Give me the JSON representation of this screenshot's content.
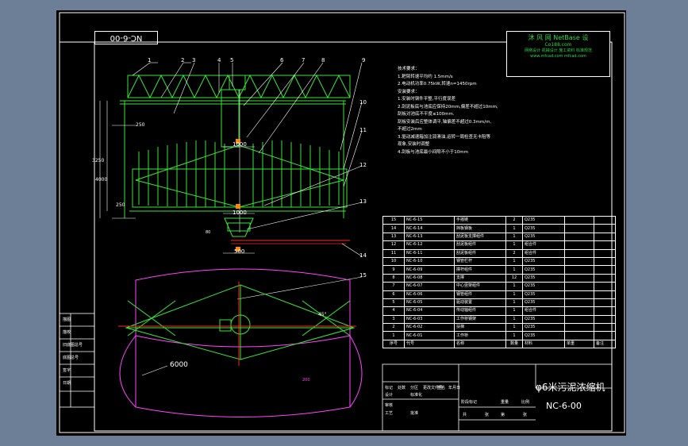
{
  "drawing": {
    "number_box": "NC-6-00",
    "title": "φ6米污泥浓缩机",
    "title_number": "NC-6-00"
  },
  "watermark": {
    "line1": "沐 风 网  NetBase 设",
    "line2": "Co188.com",
    "line3": "网络设计 机械设计 施工资料 标准规范",
    "line4": "www.mfcad.com mfcad.com"
  },
  "notes": [
    "技术要求：",
    "1.耙臂转速平均约 1.5mm/s",
    "2.电动机功率0.75kW,转速n=1450rpm",
    "安装要求：",
    "1.安装时钢件平整,平行度误差",
    "2.刮泥板底与池底应保持20mm,偏差不超过10mm,",
    "  刮板对池底不平度≤100mm.",
    "  刮板安装后应整体调平,轴偏差不超过0.3mm/m,",
    "  不超过2mm",
    "3.驱动减速箱加注润滑油,运转一周检查无卡阻等",
    "  现象,安装时调整",
    "4.刮板与池底最小间隙不小于10mm"
  ],
  "dimensions": {
    "d1000_top": "1000",
    "d1000_bottom": "1000",
    "d3250": "3250",
    "d4000": "4000",
    "d500": "500",
    "d250_a": "250",
    "d250_b": "250",
    "d6000": "6000",
    "d45": "45°",
    "d80": "80",
    "d200": "200"
  },
  "callouts": [
    "1",
    "2",
    "3",
    "4",
    "5",
    "6",
    "7",
    "8",
    "9",
    "10",
    "11",
    "12",
    "13",
    "14",
    "15"
  ],
  "bom_header": [
    "序号",
    "代号",
    "名称",
    "数量",
    "材料",
    "单重",
    "备注"
  ],
  "bom": [
    [
      "15",
      "NC-6-15",
      "手摇链",
      "2",
      "Q235",
      ""
    ],
    [
      "14",
      "NC-6-14",
      "挡板钢板",
      "1",
      "Q235",
      ""
    ],
    [
      "13",
      "NC-6-13",
      "刮泥板支撑组件",
      "1",
      "Q235",
      ""
    ],
    [
      "12",
      "NC-6-12",
      "刮泥板组件",
      "1",
      "组合件",
      ""
    ],
    [
      "11",
      "NC-6-11",
      "刮泥板组件",
      "2",
      "组合件",
      ""
    ],
    [
      "10",
      "NC-6-10",
      "钢管栏杆",
      "1",
      "Q235",
      ""
    ],
    [
      "9",
      "NC-6-09",
      "撑杆组件",
      "1",
      "Q235",
      ""
    ],
    [
      "8",
      "NC-6-08",
      "支撑",
      "12",
      "Q235",
      ""
    ],
    [
      "7",
      "NC-6-07",
      "中心竖架组件",
      "1",
      "Q235",
      ""
    ],
    [
      "6",
      "NC-6-06",
      "钢管组件",
      "1",
      "Q235",
      ""
    ],
    [
      "5",
      "NC-6-05",
      "驱动装置",
      "1",
      "Q235",
      ""
    ],
    [
      "4",
      "NC-6-04",
      "传动轴组件",
      "1",
      "组合件",
      ""
    ],
    [
      "3",
      "NC-6-03",
      "工作桥钢架",
      "1",
      "Q235",
      ""
    ],
    [
      "2",
      "NC-6-02",
      "扶梯",
      "1",
      "Q235",
      ""
    ],
    [
      "1",
      "NC-6-01",
      "工作桥",
      "1",
      "Q235",
      ""
    ]
  ],
  "title_block": {
    "labels": [
      "标记",
      "处数",
      "分区",
      "更改文件号",
      "签名",
      "年月日",
      "设计",
      "标准化",
      "审核",
      "工艺",
      "批准",
      "阶段标记",
      "重量",
      "比例",
      "共",
      "张",
      "第",
      "张"
    ]
  },
  "side_table": [
    "描图",
    "描校",
    "旧底图总号",
    "底图总号",
    "签字",
    "日期"
  ]
}
